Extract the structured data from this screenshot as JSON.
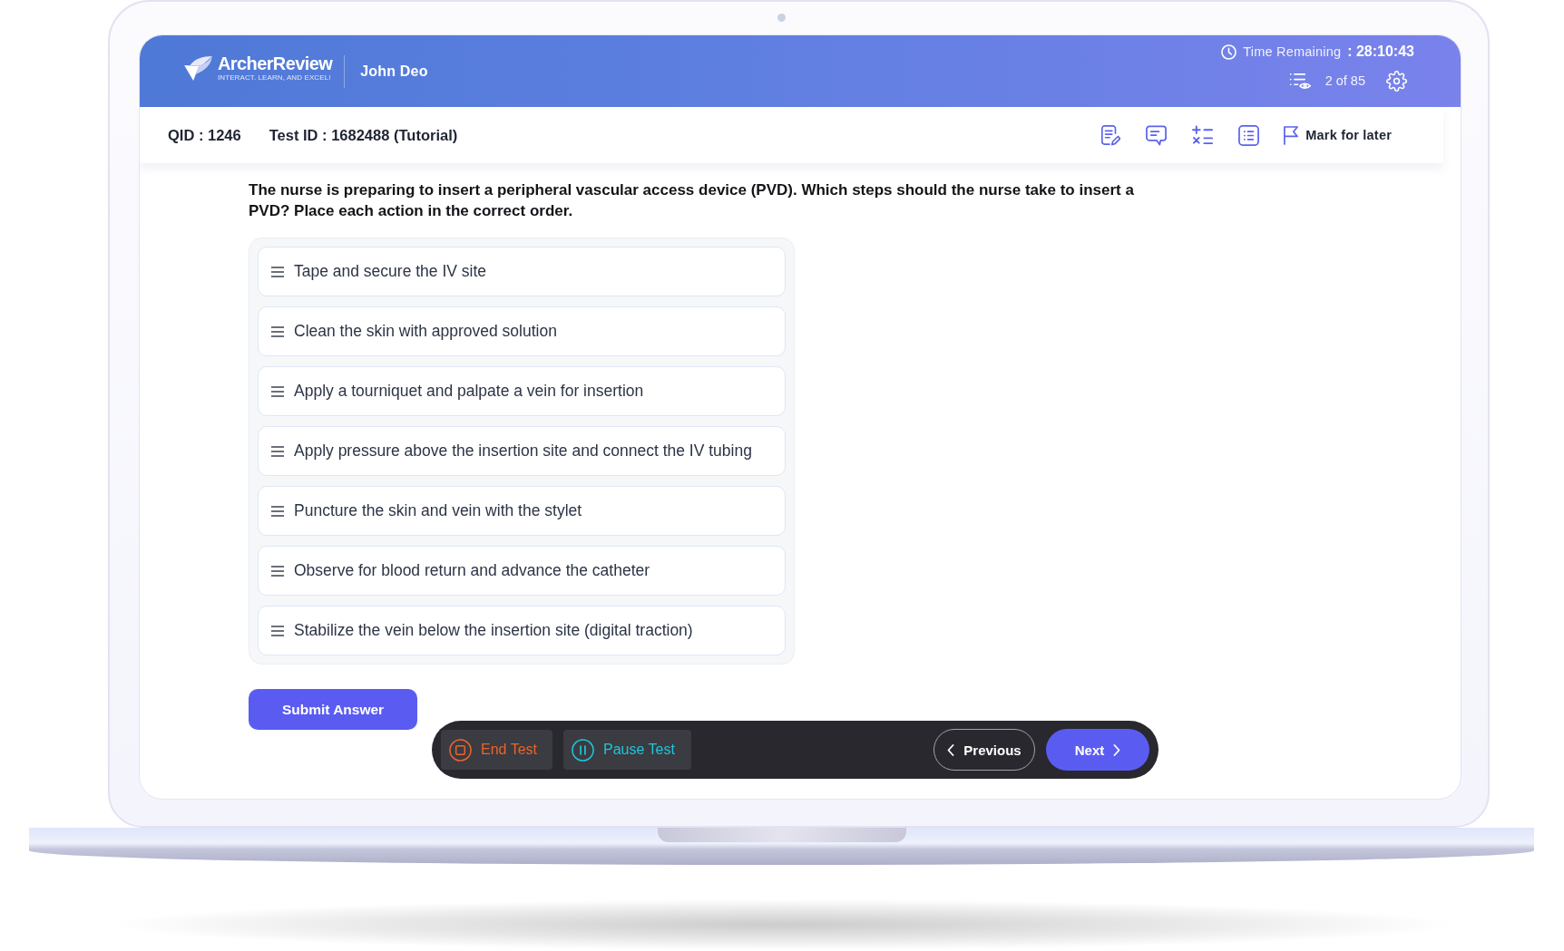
{
  "header": {
    "logo": {
      "name": "ArcherReview",
      "tagline": "INTERACT. LEARN, AND EXCEL!"
    },
    "user_name": "John Deo",
    "timer": {
      "label": "Time Remaining",
      "value": ": 28:10:43"
    },
    "progress": "2 of 85"
  },
  "toolbar": {
    "qid": "QID : 1246",
    "test_id": "Test ID : 1682488 (Tutorial)",
    "mark_for_later": "Mark for later"
  },
  "question": {
    "text": "The nurse is preparing to insert a peripheral vascular access device (PVD). Which steps should the nurse take to insert a PVD? Place each action in the correct order.",
    "options": [
      "Tape and secure the IV site",
      "Clean the skin with approved solution",
      "Apply a tourniquet and palpate a vein for insertion",
      "Apply pressure above the insertion site and connect the IV tubing",
      "Puncture the skin and vein with the stylet",
      "Observe for blood return and advance the catheter",
      "Stabilize the vein below the insertion site (digital traction)"
    ],
    "submit": "Submit Answer"
  },
  "navigation_bar": {
    "end_test": "End Test",
    "pause_test": "Pause Test",
    "previous": "Previous",
    "next": "Next"
  }
}
